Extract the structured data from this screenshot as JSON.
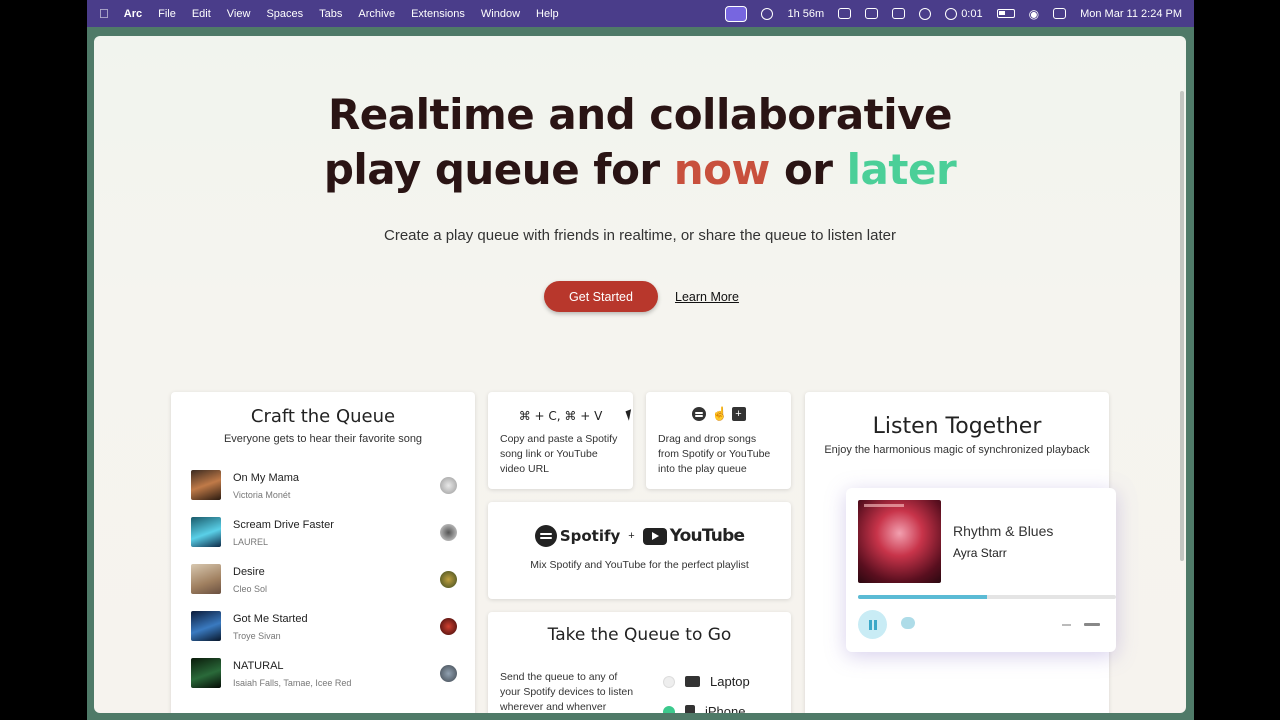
{
  "menubar": {
    "app": "Arc",
    "items": [
      "File",
      "Edit",
      "View",
      "Spaces",
      "Tabs",
      "Archive",
      "Extensions",
      "Window",
      "Help"
    ],
    "battery_time": "1h 56m",
    "recording": "0:01",
    "datetime": "Mon Mar 11  2:24 PM"
  },
  "hero": {
    "line1": "Realtime and collaborative",
    "line2_pre": "play queue for ",
    "now": "now",
    "or": " or ",
    "later": "later",
    "subtitle": "Create a play queue with friends in realtime, or share the queue to listen later",
    "cta": "Get Started",
    "learn_more": "Learn More"
  },
  "craft": {
    "title": "Craft the Queue",
    "desc": "Everyone gets to hear their favorite song",
    "songs": [
      {
        "title": "On My Mama",
        "artist": "Victoria Monét"
      },
      {
        "title": "Scream Drive Faster",
        "artist": "LAUREL"
      },
      {
        "title": "Desire",
        "artist": "Cleo Sol"
      },
      {
        "title": "Got Me Started",
        "artist": "Troye Sivan"
      },
      {
        "title": "NATURAL",
        "artist": "Isaiah Falls, Tamae, Icee Red"
      }
    ]
  },
  "copy": {
    "keys": "⌘ + C, ⌘ + V",
    "text": "Copy and paste a Spotify song link or YouTube video URL"
  },
  "drag": {
    "text": "Drag and drop songs from Spotify or YouTube into the play queue"
  },
  "mix": {
    "spotify": "Spotify",
    "plus": "+",
    "youtube": "YouTube",
    "desc": "Mix Spotify and YouTube for the perfect playlist"
  },
  "togo": {
    "title": "Take the Queue to Go",
    "text": "Send the queue to any of your Spotify devices to listen wherever and whenver",
    "devices": [
      "Laptop",
      "iPhone"
    ]
  },
  "listen": {
    "title": "Listen Together",
    "desc": "Enjoy the harmonious magic of synchronized playback",
    "track": "Rhythm & Blues",
    "artist": "Ayra Starr",
    "progress": 0.5
  }
}
